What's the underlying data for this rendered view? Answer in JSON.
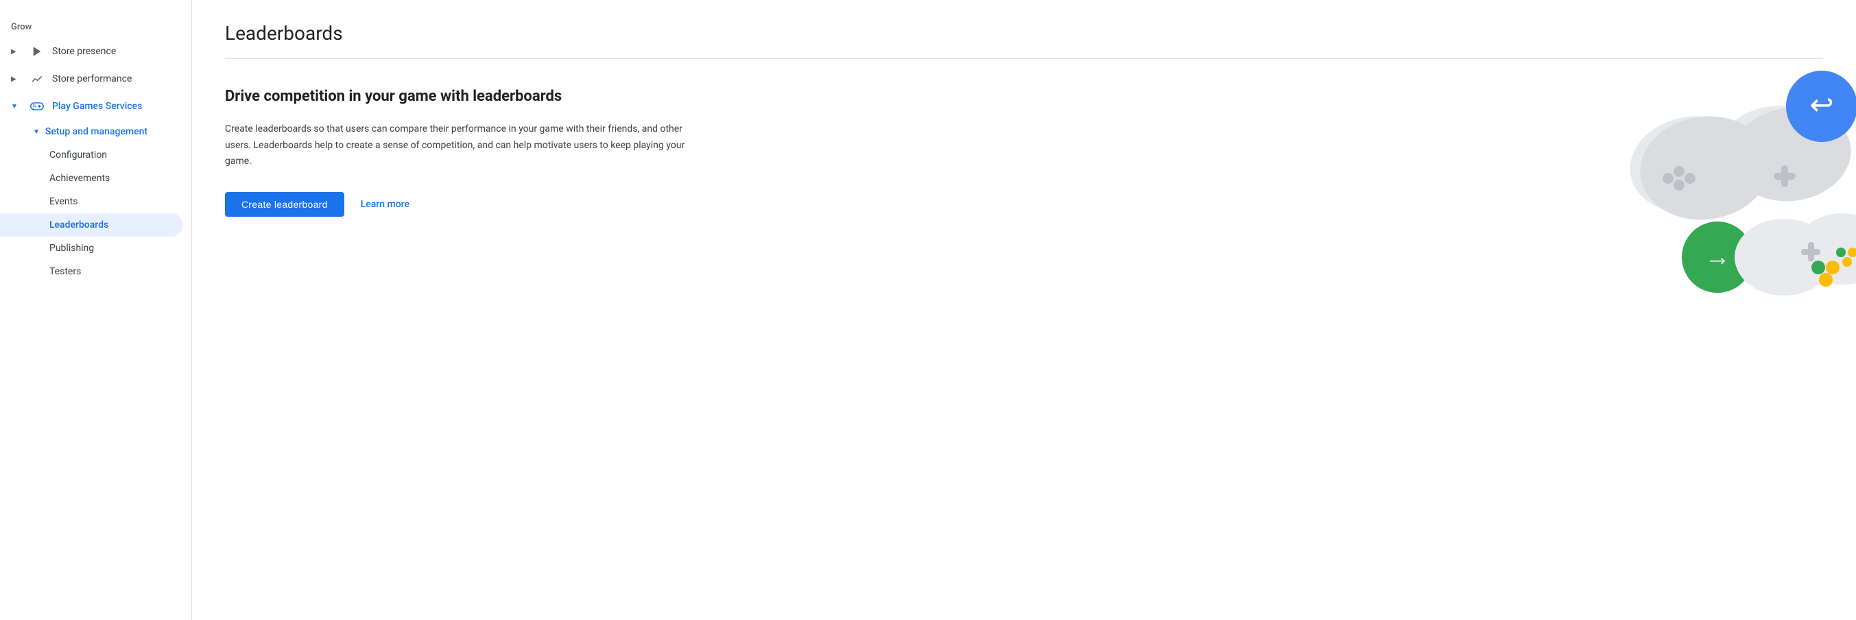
{
  "sidebar": {
    "grow_label": "Grow",
    "items": [
      {
        "id": "store-presence",
        "label": "Store presence",
        "icon": "play-icon",
        "expandable": true,
        "active": false
      },
      {
        "id": "store-performance",
        "label": "Store performance",
        "icon": "trend-icon",
        "expandable": true,
        "active": false
      },
      {
        "id": "play-games-services",
        "label": "Play Games Services",
        "icon": "gamepad-icon",
        "expandable": true,
        "expanded": true,
        "active": false,
        "blue": true,
        "subitems": [
          {
            "id": "setup-management",
            "label": "Setup and management",
            "expanded": true,
            "blue": true,
            "subitems": [
              {
                "id": "configuration",
                "label": "Configuration",
                "active": false
              },
              {
                "id": "achievements",
                "label": "Achievements",
                "active": false
              },
              {
                "id": "events",
                "label": "Events",
                "active": false
              },
              {
                "id": "leaderboards",
                "label": "Leaderboards",
                "active": true
              },
              {
                "id": "publishing",
                "label": "Publishing",
                "active": false
              },
              {
                "id": "testers",
                "label": "Testers",
                "active": false
              }
            ]
          }
        ]
      }
    ]
  },
  "main": {
    "page_title": "Leaderboards",
    "content_heading": "Drive competition in your game with leaderboards",
    "content_description": "Create leaderboards so that users can compare their performance in your game with their friends, and other users. Leaderboards help to create a sense of competition, and can help motivate users to keep playing your game.",
    "create_button_label": "Create leaderboard",
    "learn_more_label": "Learn more"
  },
  "colors": {
    "accent": "#1a73e8",
    "active_bg": "#e8f0fe",
    "green": "#34a853",
    "blue": "#4285f4",
    "yellow": "#fbbc04",
    "light_gray": "#dadce0",
    "mid_gray": "#9aa0a6"
  }
}
